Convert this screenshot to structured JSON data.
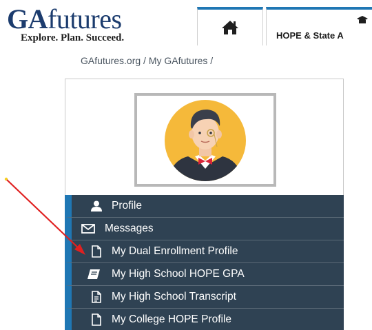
{
  "logo": {
    "ga": "GA",
    "futures": "futures",
    "tagline": "Explore. Plan. Succeed."
  },
  "nav": {
    "home_icon": "home-icon",
    "hope_label": "HOPE & State A",
    "hope_icon": "graduation-cap-icon"
  },
  "breadcrumb": "GAfutures.org / My GAfutures /",
  "avatar": {
    "description_icon": "user-avatar"
  },
  "menu": {
    "items": [
      {
        "label": "Profile",
        "icon": "user-icon"
      },
      {
        "label": "Messages",
        "icon": "envelope-icon"
      },
      {
        "label": "My Dual Enrollment Profile",
        "icon": "file-icon"
      },
      {
        "label": "My High School HOPE GPA",
        "icon": "book-icon"
      },
      {
        "label": "My High School Transcript",
        "icon": "file-text-icon"
      },
      {
        "label": "My College HOPE Profile",
        "icon": "file-icon"
      }
    ]
  },
  "colors": {
    "menu_bg": "#2f4253",
    "accent_blue": "#1f77b4",
    "logo_navy": "#1c3c6e",
    "avatar_bg": "#f5b93a",
    "arrow_red": "#e02020"
  }
}
